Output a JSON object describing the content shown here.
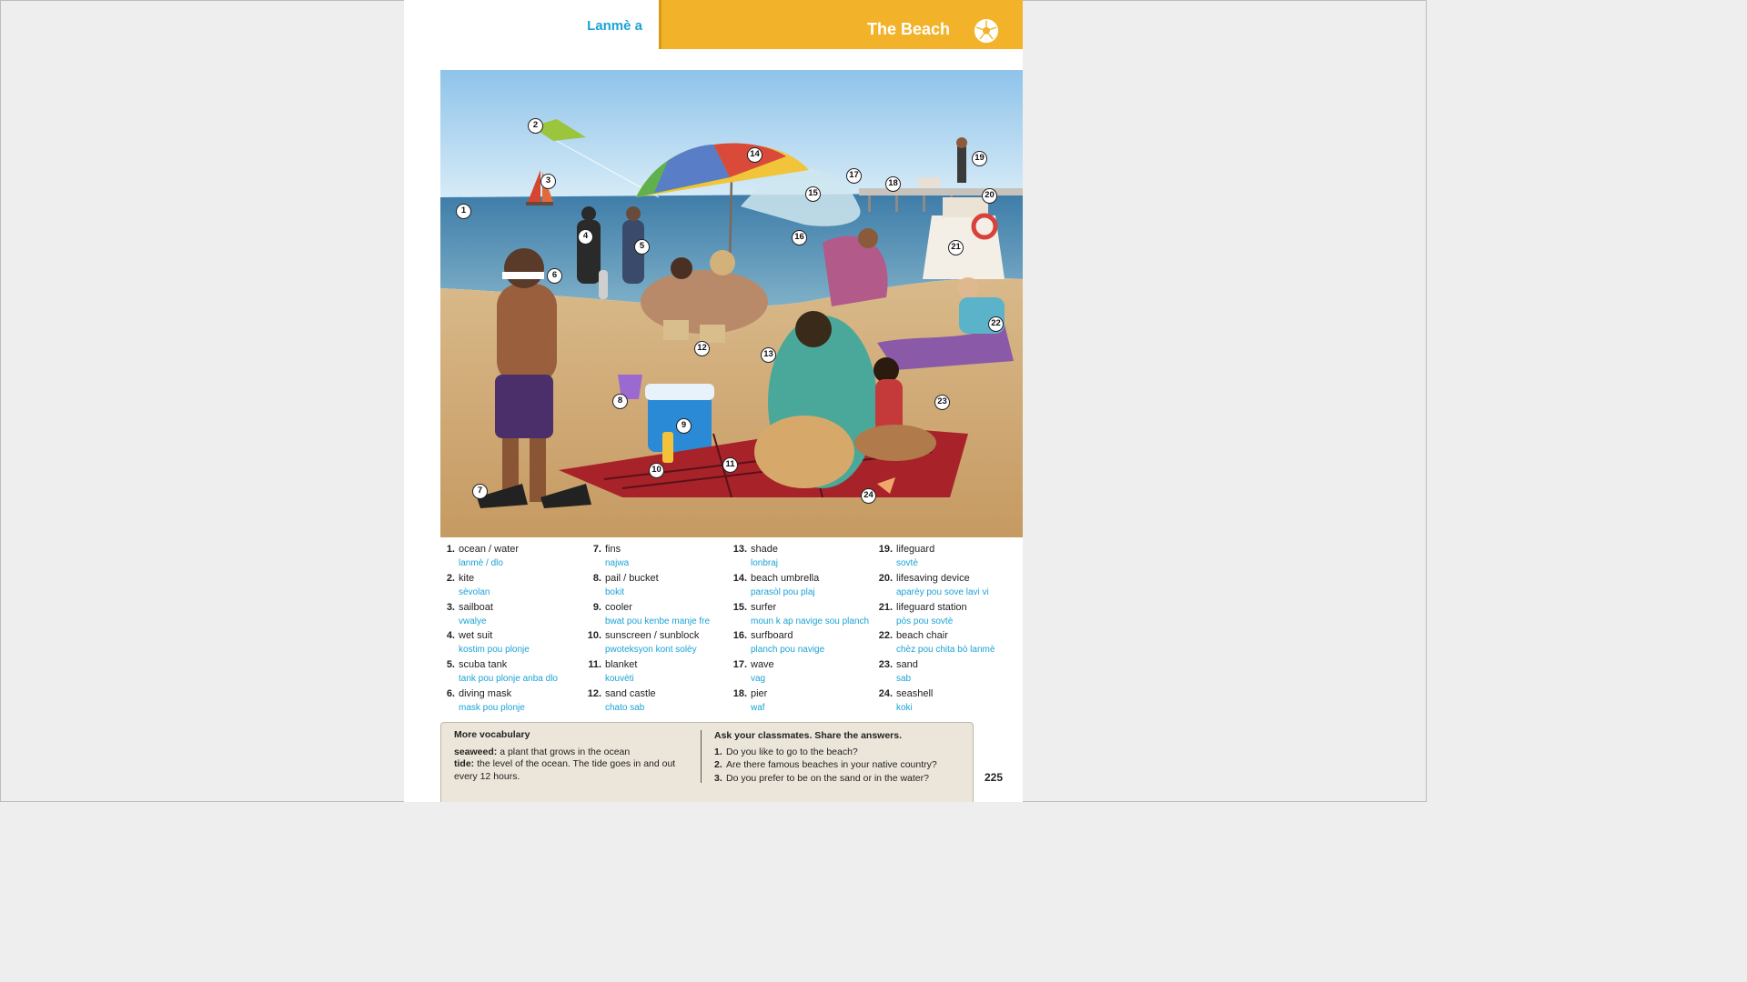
{
  "header": {
    "left_title": "Lanmè a",
    "right_title": "The Beach",
    "icon": "beach-ball-icon"
  },
  "colors": {
    "accent_blue": "#1aa3d6",
    "header_orange": "#f2b32a",
    "box_bg": "#ece6da"
  },
  "markers": [
    "1",
    "2",
    "3",
    "4",
    "5",
    "6",
    "7",
    "8",
    "9",
    "10",
    "11",
    "12",
    "13",
    "14",
    "15",
    "16",
    "17",
    "18",
    "19",
    "20",
    "21",
    "22",
    "23",
    "24"
  ],
  "vocabulary": [
    {
      "num": "1.",
      "term": "ocean / water",
      "translation": "lanmè / dlo"
    },
    {
      "num": "2.",
      "term": "kite",
      "translation": "sèvolan"
    },
    {
      "num": "3.",
      "term": "sailboat",
      "translation": "vwalye"
    },
    {
      "num": "4.",
      "term": "wet suit",
      "translation": "kostim pou plonje"
    },
    {
      "num": "5.",
      "term": "scuba tank",
      "translation": "tank pou plonje anba dlo"
    },
    {
      "num": "6.",
      "term": "diving mask",
      "translation": "mask pou plonje"
    },
    {
      "num": "7.",
      "term": "fins",
      "translation": "najwa"
    },
    {
      "num": "8.",
      "term": "pail / bucket",
      "translation": "bokit"
    },
    {
      "num": "9.",
      "term": "cooler",
      "translation": "bwat pou kenbe manje fre"
    },
    {
      "num": "10.",
      "term": "sunscreen / sunblock",
      "translation": "pwoteksyon kont solèy"
    },
    {
      "num": "11.",
      "term": "blanket",
      "translation": "kouvèti"
    },
    {
      "num": "12.",
      "term": "sand castle",
      "translation": "chato sab"
    },
    {
      "num": "13.",
      "term": "shade",
      "translation": "lonbraj"
    },
    {
      "num": "14.",
      "term": "beach umbrella",
      "translation": "parasòl pou plaj"
    },
    {
      "num": "15.",
      "term": "surfer",
      "translation": "moun k ap navige sou planch"
    },
    {
      "num": "16.",
      "term": "surfboard",
      "translation": "planch pou navige"
    },
    {
      "num": "17.",
      "term": "wave",
      "translation": "vag"
    },
    {
      "num": "18.",
      "term": "pier",
      "translation": "waf"
    },
    {
      "num": "19.",
      "term": "lifeguard",
      "translation": "sovtè"
    },
    {
      "num": "20.",
      "term": "lifesaving device",
      "translation": "aparèy pou sove lavi vi"
    },
    {
      "num": "21.",
      "term": "lifeguard station",
      "translation": "pòs pou sovtè"
    },
    {
      "num": "22.",
      "term": "beach chair",
      "translation": "chèz pou chita bò lanmè"
    },
    {
      "num": "23.",
      "term": "sand",
      "translation": "sab"
    },
    {
      "num": "24.",
      "term": "seashell",
      "translation": "koki"
    }
  ],
  "more_vocabulary": {
    "title": "More vocabulary",
    "items": [
      {
        "term": "seaweed:",
        "definition": " a plant that grows in the ocean"
      },
      {
        "term": "tide:",
        "definition": " the level of the ocean. The tide goes in and out every 12 hours."
      }
    ]
  },
  "ask_classmates": {
    "title": "Ask your classmates. Share the answers.",
    "questions": [
      {
        "num": "1.",
        "text": "Do you like to go to the beach?"
      },
      {
        "num": "2.",
        "text": "Are there famous beaches in your native country?"
      },
      {
        "num": "3.",
        "text": "Do you prefer to be on the sand or in the water?"
      }
    ]
  },
  "page_number": "225"
}
